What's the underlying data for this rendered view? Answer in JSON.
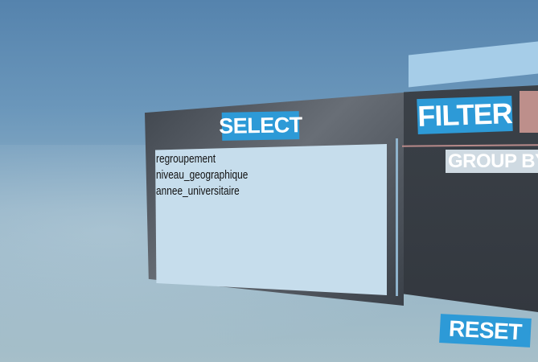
{
  "select_panel": {
    "title": "SELECT",
    "items": [
      "regroupement",
      "niveau_geographique",
      "annee_universitaire"
    ]
  },
  "filter_panel": {
    "title": "FILTER",
    "group_by_label": "GROUP BY"
  },
  "reset_label": "RESET",
  "colors": {
    "accent": "#2d9ad7",
    "panel": "#3d434a",
    "list_bg": "#c6ddec",
    "swatch": "#bd8f8b"
  }
}
